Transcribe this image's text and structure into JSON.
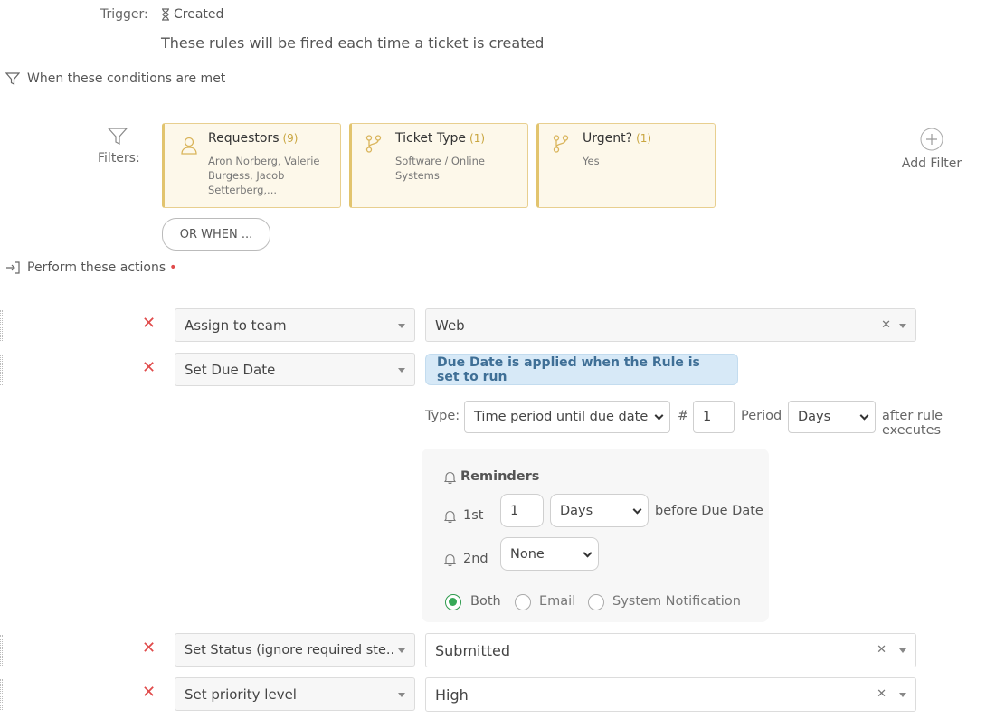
{
  "trigger": {
    "label": "Trigger:",
    "value": "Created",
    "description": "These rules will be fired each time a ticket is created"
  },
  "conditions": {
    "title": "When these conditions are met",
    "filters_label": "Filters:",
    "filters": [
      {
        "title": "Requestors",
        "count": "(9)",
        "line1": "Aron Norberg, Valerie",
        "line2": "Burgess, Jacob",
        "line3": "Setterberg,...",
        "icon": "user-icon"
      },
      {
        "title": "Ticket Type",
        "count": "(1)",
        "line1": "Software / Online",
        "line2": "Systems",
        "icon": "branch-icon"
      },
      {
        "title": "Urgent?",
        "count": "(1)",
        "line1": "Yes",
        "icon": "branch-icon"
      }
    ],
    "add_filter": "Add Filter",
    "or_when": "OR WHEN ..."
  },
  "actions": {
    "title": "Perform these actions",
    "required_marker": "•",
    "rows": [
      {
        "action": "Assign to team",
        "value": "Web"
      },
      {
        "action": "Set Due Date",
        "info": "Due Date is applied when the Rule is set to run"
      },
      {
        "action": "Set Status (ignore required ste...",
        "value": "Submitted"
      },
      {
        "action": "Set priority level",
        "value": "High"
      }
    ],
    "due_date": {
      "type_label": "Type:",
      "type_value": "Time period until due date",
      "hash_label": "#",
      "period_number": "1",
      "period_label": "Period",
      "period_value": "Days",
      "after_text": "after rule executes",
      "reminders": {
        "title": "Reminders",
        "first_label": "1st",
        "first_number": "1",
        "first_unit": "Days",
        "first_after": "before Due Date",
        "second_label": "2nd",
        "second_value": "None",
        "options": [
          "Both",
          "Email",
          "System Notification"
        ],
        "selected": "Both"
      }
    }
  },
  "colors": {
    "filter_bg": "#fdf8ea",
    "filter_border": "#e8cf8f",
    "remove_red": "#e04b4b",
    "info_bg": "#d7e9f7",
    "radio_green": "#36a957"
  }
}
